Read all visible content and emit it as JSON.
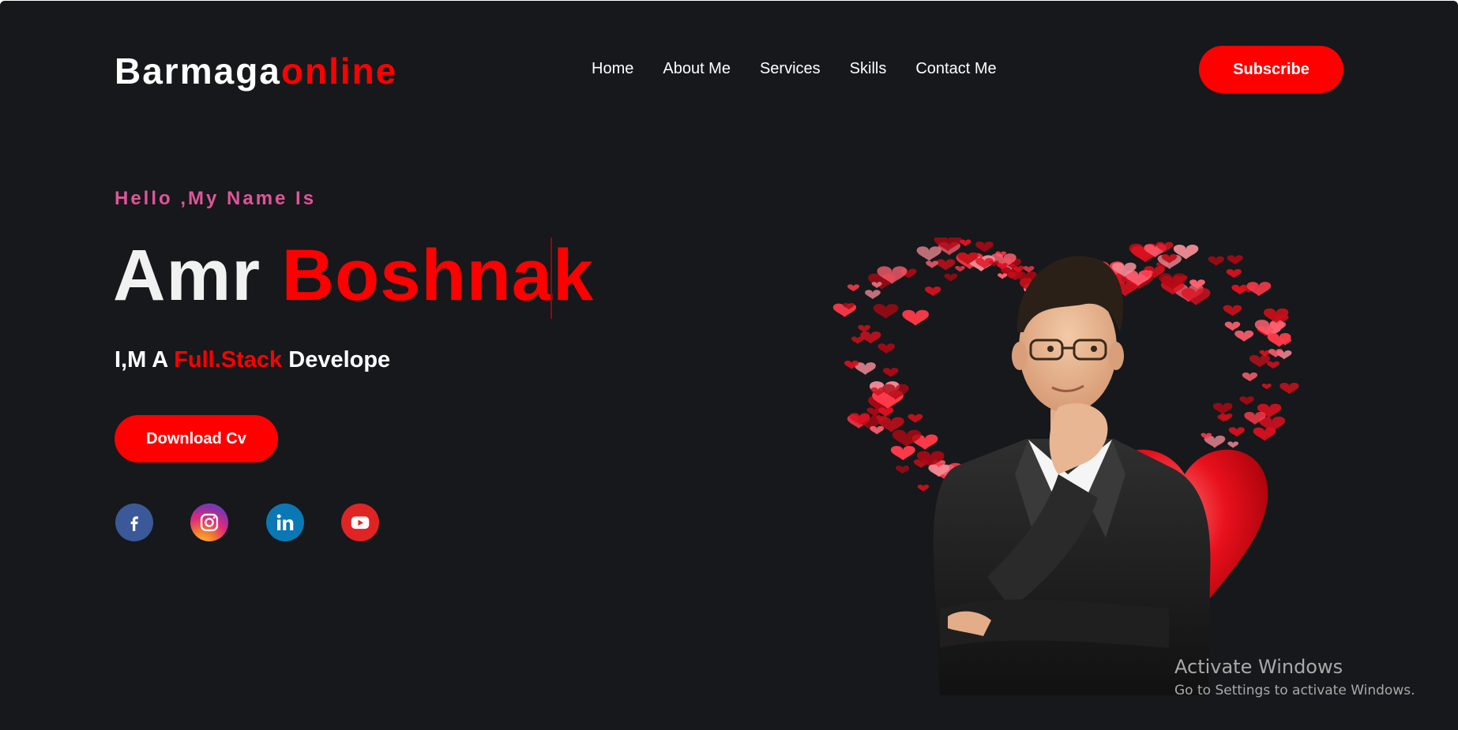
{
  "brand": {
    "part1": "Barmaga",
    "part2": "online",
    "accent": "#ff0000"
  },
  "nav": [
    {
      "label": "Home"
    },
    {
      "label": "About Me"
    },
    {
      "label": "Services"
    },
    {
      "label": "Skills"
    },
    {
      "label": "Contact Me"
    }
  ],
  "header": {
    "subscribe_label": "Subscribe"
  },
  "hero": {
    "greeting": "Hello ,My Name Is",
    "first_name": "Amr",
    "last_name": "Boshnak",
    "role_prefix": "I,M A ",
    "role_highlight": "Full.Stack",
    "role_suffix": " Develope",
    "download_label": "Download Cv"
  },
  "social": [
    {
      "name": "facebook-icon",
      "color": "#3b5998"
    },
    {
      "name": "instagram-icon",
      "color": "#dd2a7b"
    },
    {
      "name": "linkedin-icon",
      "color": "#0a78b5"
    },
    {
      "name": "youtube-icon",
      "color": "#e02424"
    }
  ],
  "watermark": {
    "title": "Activate Windows",
    "subtitle": "Go to Settings to activate Windows."
  },
  "colors": {
    "background": "#16181b",
    "accent": "#ff0000",
    "greeting": "#e0559a"
  }
}
